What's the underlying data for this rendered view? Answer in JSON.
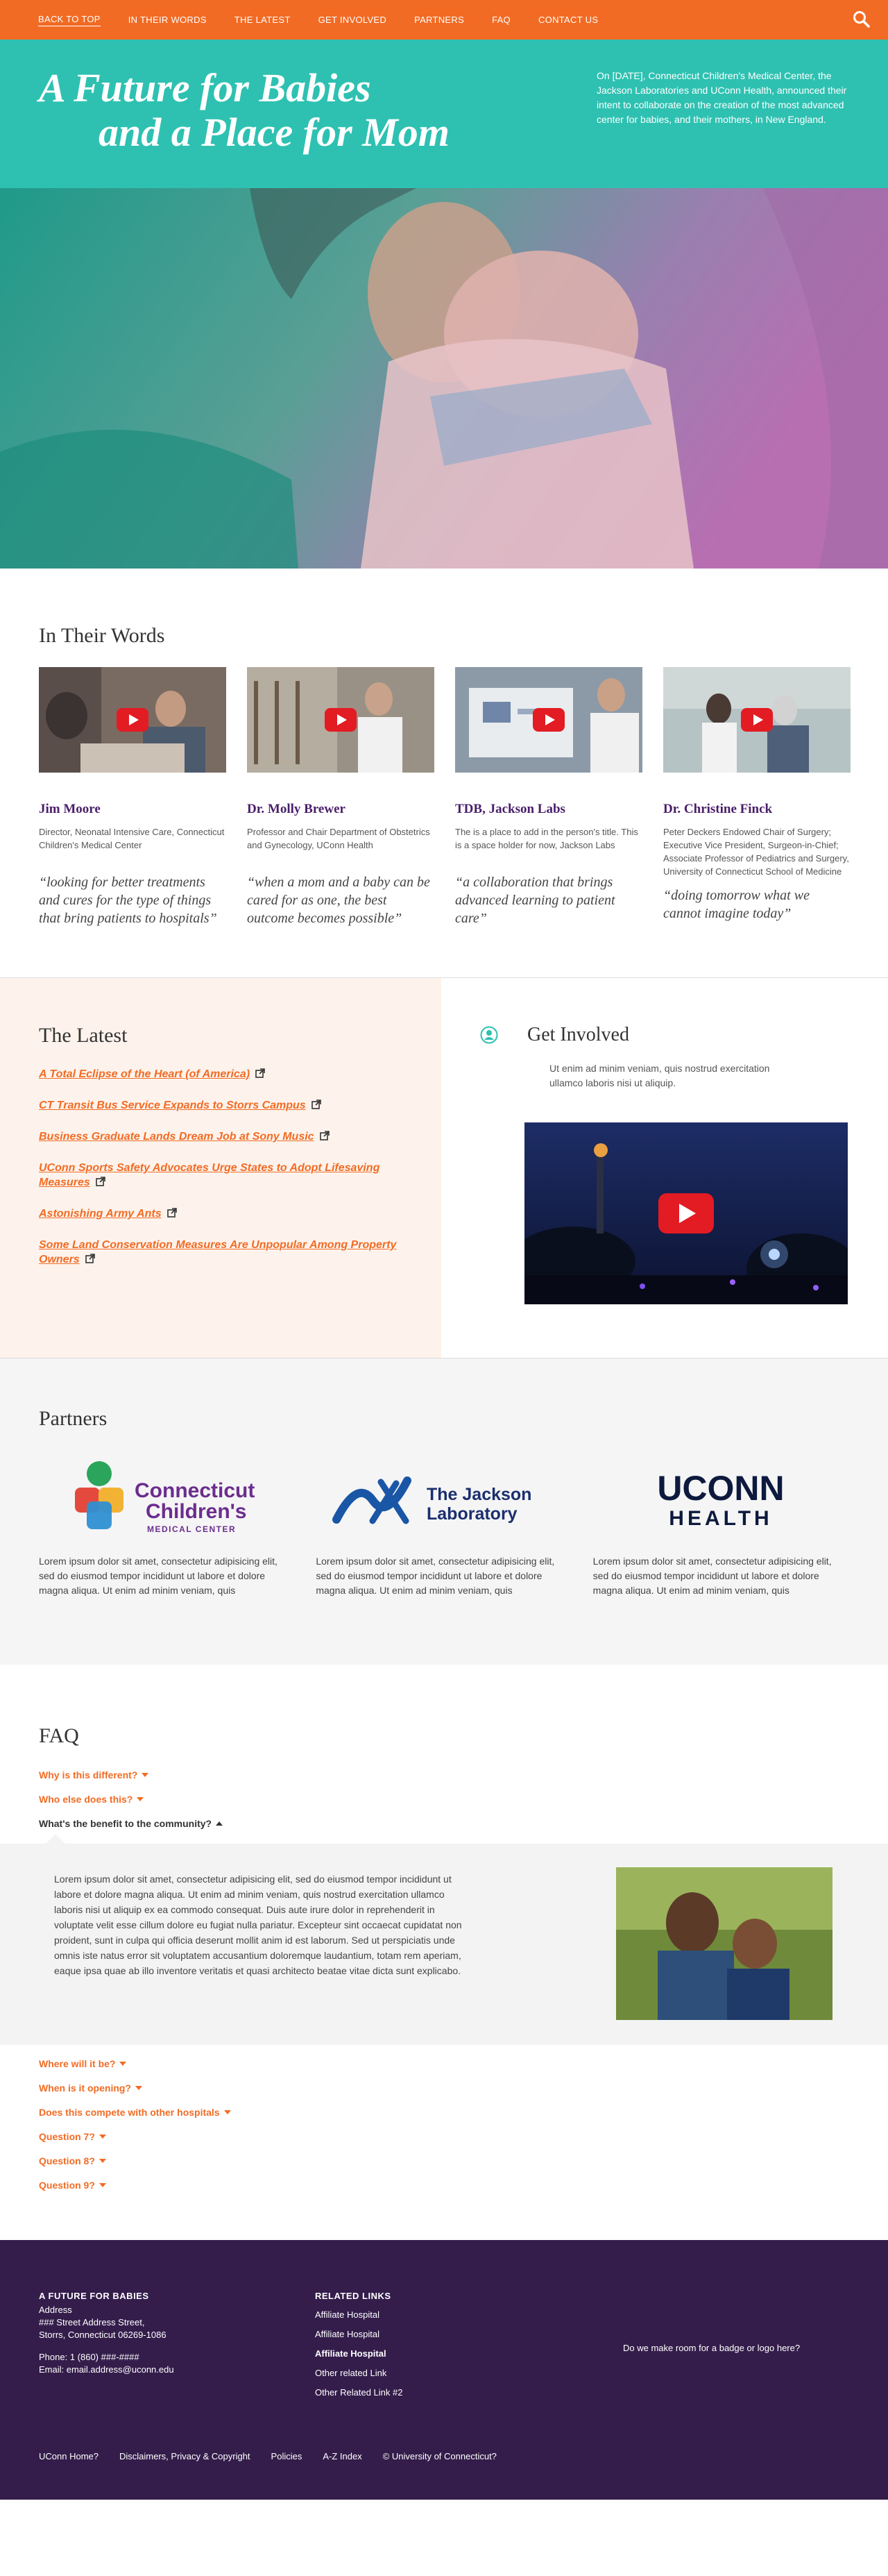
{
  "nav": {
    "items": [
      "BACK TO TOP",
      "IN THEIR WORDS",
      "THE LATEST",
      "GET INVOLVED",
      "PARTNERS",
      "FAQ",
      "CONTACT US"
    ],
    "search_icon": "search-icon"
  },
  "hero": {
    "title_line1": "A Future for Babies",
    "title_line2": "and a Place for Mom",
    "intro": "On [DATE], Connecticut Children's Medical Center, the Jackson Laboratories and UConn Health, announced their intent to collaborate on the creation of the most advanced center for babies, and their mothers, in New England."
  },
  "words": {
    "title": "In Their Words",
    "cards": [
      {
        "name": "Jim Moore",
        "role": "Director, Neonatal Intensive Care, Connecticut Children's Medical Center",
        "quote": "“looking for better treatments and cures for the type of things that bring patients to hospitals”"
      },
      {
        "name": "Dr. Molly Brewer",
        "role": "Professor and Chair Department of Obstetrics and Gynecology, UConn Health",
        "quote": "“when a mom and a baby can be cared for as one, the best outcome becomes possible”"
      },
      {
        "name": "TDB, Jackson Labs",
        "role": "The is a place to add in the person's title. This is a space holder for now, Jackson Labs",
        "quote": "“a collaboration that brings advanced learning to patient care”"
      },
      {
        "name": "Dr. Christine Finck",
        "role": "Peter Deckers Endowed Chair of Surgery; Executive Vice President, Surgeon-in-Chief; Associate Professor of Pediatrics and Surgery, University of Connecticut School of Medicine",
        "quote": "“doing tomorrow what we cannot imagine today”"
      }
    ]
  },
  "latest": {
    "title": "The Latest",
    "links": [
      "A Total Eclipse of the Heart (of America)",
      "CT Transit Bus Service Expands to Storrs Campus",
      "Business Graduate Lands Dream Job at Sony Music",
      "UConn Sports Safety Advocates Urge States to Adopt Lifesaving Measures",
      "Astonishing Army Ants",
      "Some Land Conservation Measures Are Unpopular Among Property Owners"
    ]
  },
  "involved": {
    "title": "Get Involved",
    "text": "Ut enim ad minim veniam, quis nostrud exercitation ullamco laboris nisi ut aliquip."
  },
  "partners": {
    "title": "Partners",
    "items": [
      {
        "logo_line1": "Connecticut",
        "logo_line2": "Children's",
        "logo_line3": "MEDICAL CENTER",
        "text": "Lorem ipsum dolor sit amet, consectetur adipisicing elit, sed do eiusmod tempor incididunt ut labore et dolore magna aliqua. Ut enim ad minim veniam, quis"
      },
      {
        "logo_line1": "The Jackson",
        "logo_line2": "Laboratory",
        "text": "Lorem ipsum dolor sit amet, consectetur adipisicing elit, sed do eiusmod tempor incididunt ut labore et dolore magna aliqua. Ut enim ad minim veniam, quis"
      },
      {
        "logo_line1": "UCONN",
        "logo_line2": "HEALTH",
        "text": "Lorem ipsum dolor sit amet, consectetur adipisicing elit, sed do eiusmod tempor incididunt ut labore et dolore magna aliqua. Ut enim ad minim veniam, quis"
      }
    ]
  },
  "faq": {
    "title": "FAQ",
    "questions_before": [
      "Why is this different?",
      "Who else does this?"
    ],
    "open_question": "What's the benefit to the community?",
    "answer": "Lorem ipsum dolor sit amet, consectetur adipisicing elit, sed do eiusmod tempor incididunt ut labore et dolore magna aliqua. Ut enim ad minim veniam, quis nostrud exercitation ullamco laboris nisi ut aliquip ex ea commodo consequat. Duis aute irure dolor in reprehenderit in voluptate velit esse cillum dolore eu fugiat nulla pariatur. Excepteur sint occaecat cupidatat non proident, sunt in culpa qui officia deserunt mollit anim id est laborum. Sed ut perspiciatis unde omnis iste natus error sit voluptatem accusantium doloremque laudantium, totam rem aperiam, eaque ipsa quae ab illo inventore veritatis et quasi architecto beatae vitae dicta sunt explicabo.",
    "questions_after": [
      "Where will it be?",
      "When is it opening?",
      "Does this compete with other hospitals",
      "Question 7?",
      "Question 8?",
      "Question 9?"
    ]
  },
  "footer": {
    "org_title": "A FUTURE FOR BABIES",
    "address_label": "Address",
    "address_line1": "### Street Address Street,",
    "address_line2": "Storrs, Connecticut 06269-1086",
    "phone": "Phone: 1 (860) ###-####",
    "email": "Email: email.address@uconn.edu",
    "related_title": "RELATED LINKS",
    "related_links": [
      "Affiliate Hospital",
      "Affiliate Hospital",
      "Affiliate Hospital",
      "Other related Link",
      "Other Related Link #2"
    ],
    "badge_text": "Do we make room for a badge or logo here?",
    "bottom_links": [
      "UConn Home?",
      "Disclaimers, Privacy & Copyright",
      "Policies",
      "A-Z Index",
      "© University of Connecticut?"
    ]
  },
  "colors": {
    "orange": "#f26b24",
    "teal": "#2ec1b1",
    "purple": "#341d4b",
    "name_purple": "#4a1e6a"
  }
}
